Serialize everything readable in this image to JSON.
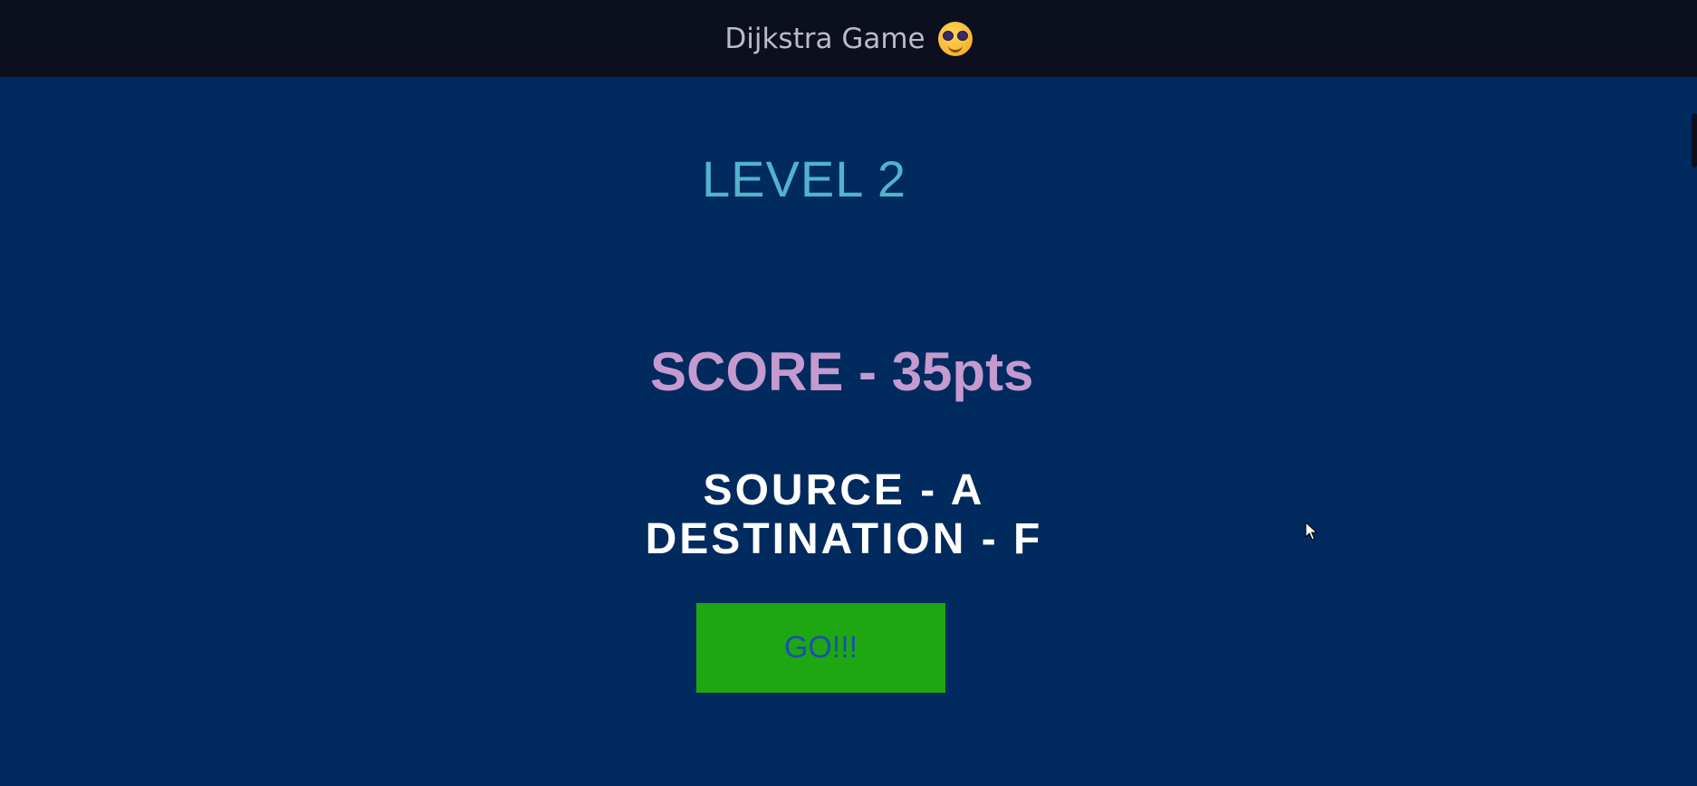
{
  "window": {
    "title": "Dijkstra Game",
    "title_icon": "sunglasses-emoji-icon"
  },
  "game": {
    "level_label": "LEVEL 2",
    "score_label": "SCORE - 35pts",
    "source_label": "SOURCE - A",
    "destination_label": "DESTINATION - F",
    "go_button_label": "GO!!!"
  },
  "colors": {
    "background": "#012a5e",
    "titlebar": "#0c0f1d",
    "level_text": "#4fb4cc",
    "score_text": "#c49ad0",
    "button_bg": "#1ea712",
    "button_text": "#1c4fb0"
  }
}
